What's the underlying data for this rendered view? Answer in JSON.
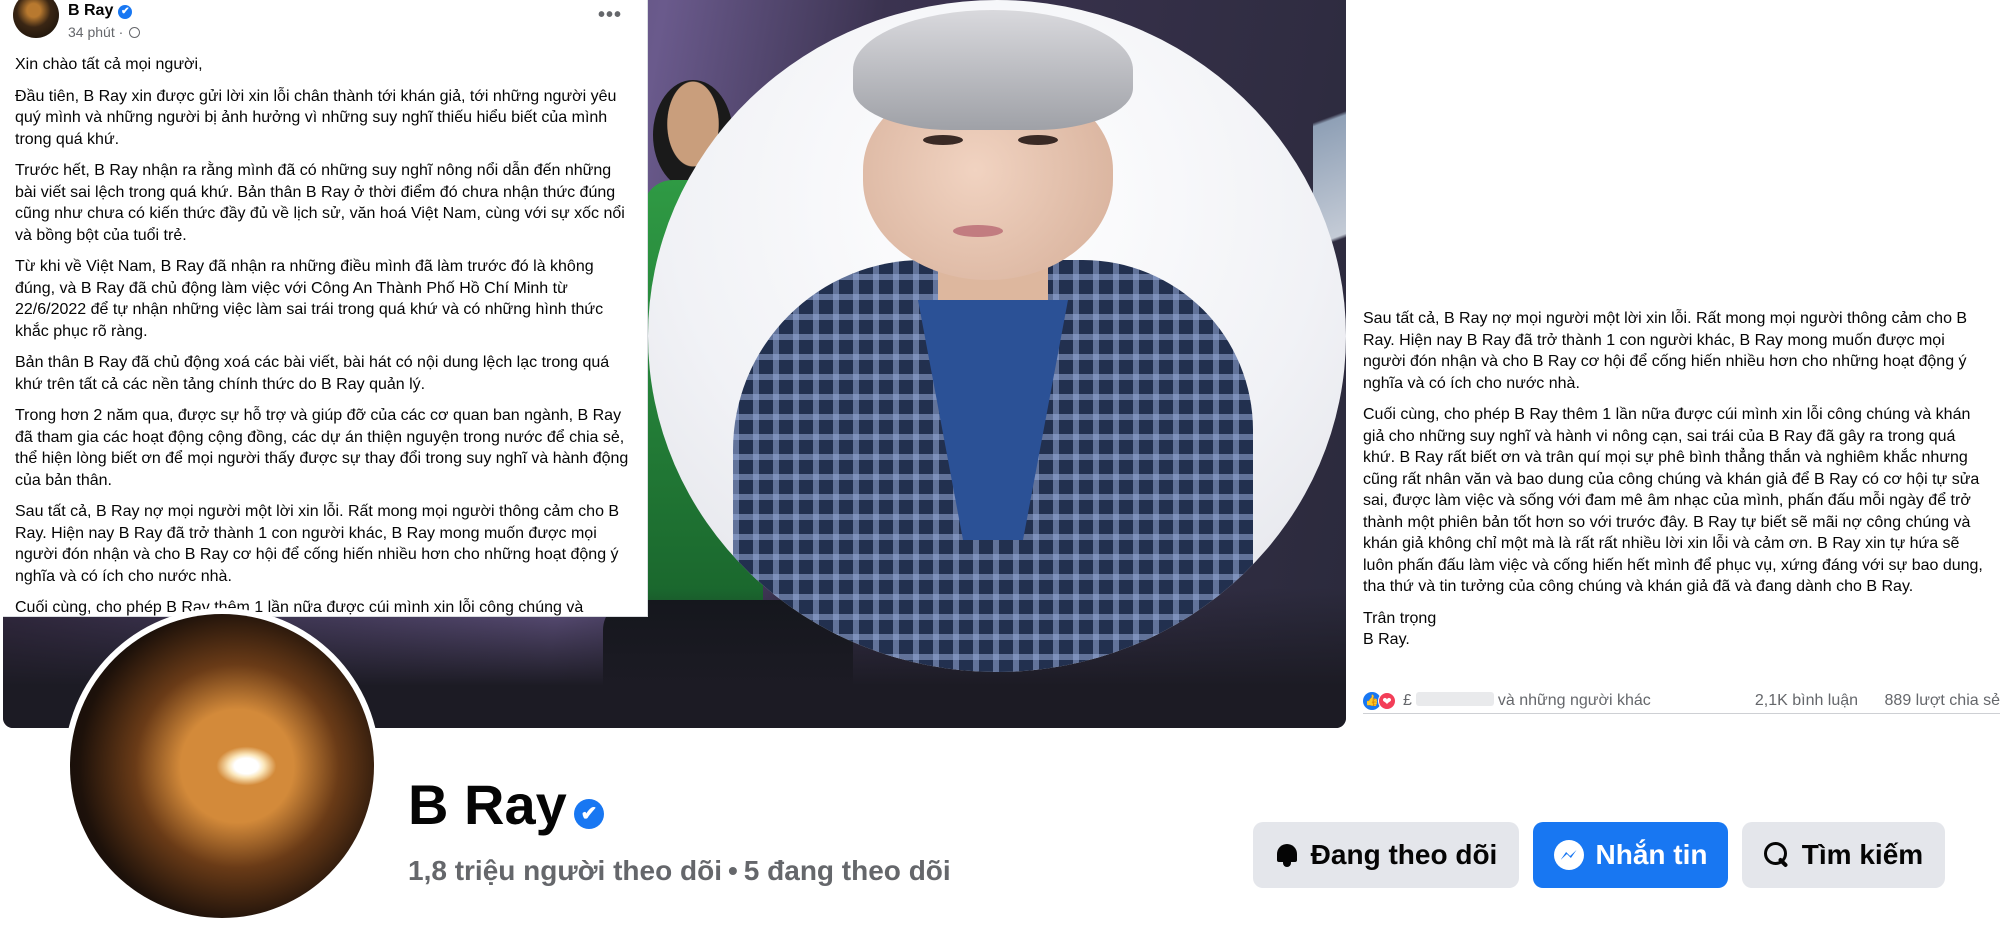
{
  "post_left": {
    "author": "B Ray",
    "time": "34 phút",
    "separator": "·",
    "paragraphs": [
      "Xin chào tất cả mọi người,",
      "Đầu tiên, B Ray xin được gửi lời xin lỗi chân thành tới khán giả, tới những người yêu quý mình và những người bị ảnh hưởng vì những suy nghĩ thiếu hiểu biết của mình trong quá khứ.",
      "Trước hết, B Ray nhận ra rằng mình đã có những suy nghĩ nông nổi dẫn đến những bài viết sai lệch trong quá khứ. Bản thân B Ray ở thời điểm đó chưa nhận thức đúng cũng như chưa có kiến thức đầy đủ về lịch sử, văn hoá Việt Nam, cùng với sự xốc nổi và bồng bột của tuổi trẻ.",
      "Từ khi về Việt Nam, B Ray đã nhận ra những điều mình đã làm trước đó là không đúng, và B Ray đã chủ động làm việc với Công An Thành Phố Hồ Chí Minh từ 22/6/2022 để tự nhận những việc làm sai trái trong quá khứ và có những hình thức khắc phục rõ ràng.",
      "Bản thân B Ray đã chủ động xoá các bài viết, bài hát có nội dung lệch lạc trong quá khứ trên tất cả các nền tảng chính thức do B Ray quản lý.",
      "Trong hơn 2 năm qua, được sự hỗ trợ và giúp đỡ của các cơ quan ban ngành, B Ray đã tham gia các hoạt động cộng đồng, các dự án thiện nguyện trong nước để chia sẻ, thể hiện lòng biết ơn để mọi người thấy được sự thay đổi trong suy nghĩ và hành động của bản thân.",
      "Sau tất cả, B Ray nợ mọi người một lời xin lỗi. Rất mong mọi người thông cảm cho B Ray. Hiện nay B Ray đã trở thành 1 con người khác, B Ray mong muốn được mọi người đón nhận và cho B Ray cơ hội để cống hiến nhiều hơn cho những hoạt động ý nghĩa và có ích cho nước nhà.",
      "Cuối cùng, cho phép B Ray thêm 1 lần nữa được cúi mình xin lỗi công chúng và"
    ]
  },
  "post_right": {
    "paragraphs": [
      "Sau tất cả, B Ray nợ mọi người một lời xin lỗi. Rất mong mọi người thông cảm cho B Ray. Hiện nay B Ray đã trở thành 1 con người khác, B Ray mong muốn được mọi người đón nhận và cho B Ray cơ hội để cống hiến nhiều hơn cho những hoạt động ý nghĩa và có ích cho nước nhà.",
      "Cuối cùng, cho phép B Ray thêm 1 lần nữa được cúi mình xin lỗi công chúng và khán giả cho những suy nghĩ và hành vi nông cạn, sai trái của B Ray đã gây ra trong quá khứ. B Ray rất biết ơn và trân quí mọi sự phê bình thẳng thắn và nghiêm khắc nhưng cũng rất nhân văn và bao dung của công chúng và khán giả để B Ray có cơ hội tự sửa sai, được làm việc và sống với đam mê âm nhạc của mình, phấn đấu mỗi ngày để trở thành một phiên bản tốt hơn so với trước đây. B Ray tự biết sẽ mãi nợ công chúng và khán giả không chỉ một mà là rất rất nhiều lời xin lỗi và cảm ơn. B Ray xin tự hứa sẽ luôn phấn đấu làm việc và cống hiến hết mình để phục vụ, xứng đáng với sự bao dung, tha thứ và tin tưởng của công chúng và khán giả đã và đang dành cho B Ray."
    ],
    "signoff_1": "Trân trọng",
    "signoff_2": "B Ray.",
    "reactions": {
      "like_glyph": "👍",
      "love_glyph": "❤",
      "names_prefix": "£",
      "others_text": "và những người khác",
      "comments": "2,1K bình luận",
      "shares": "889 lượt chia sẻ"
    }
  },
  "profile": {
    "name": "B Ray",
    "verified_glyph": "✔",
    "followers": "1,8 triệu người theo dõi",
    "dot": "•",
    "following": "5 đang theo dõi"
  },
  "actions": {
    "follow_label": "Đang theo dõi",
    "message_label": "Nhắn tin",
    "search_label": "Tìm kiếm"
  },
  "colors": {
    "accent": "#1877f2",
    "secondary_button": "#e4e6eb",
    "muted_text": "#65676b"
  },
  "icons": [
    "more-dots-icon",
    "globe-icon",
    "verified-badge-icon",
    "like-reaction-icon",
    "love-reaction-icon",
    "bell-icon",
    "messenger-icon",
    "search-icon"
  ]
}
